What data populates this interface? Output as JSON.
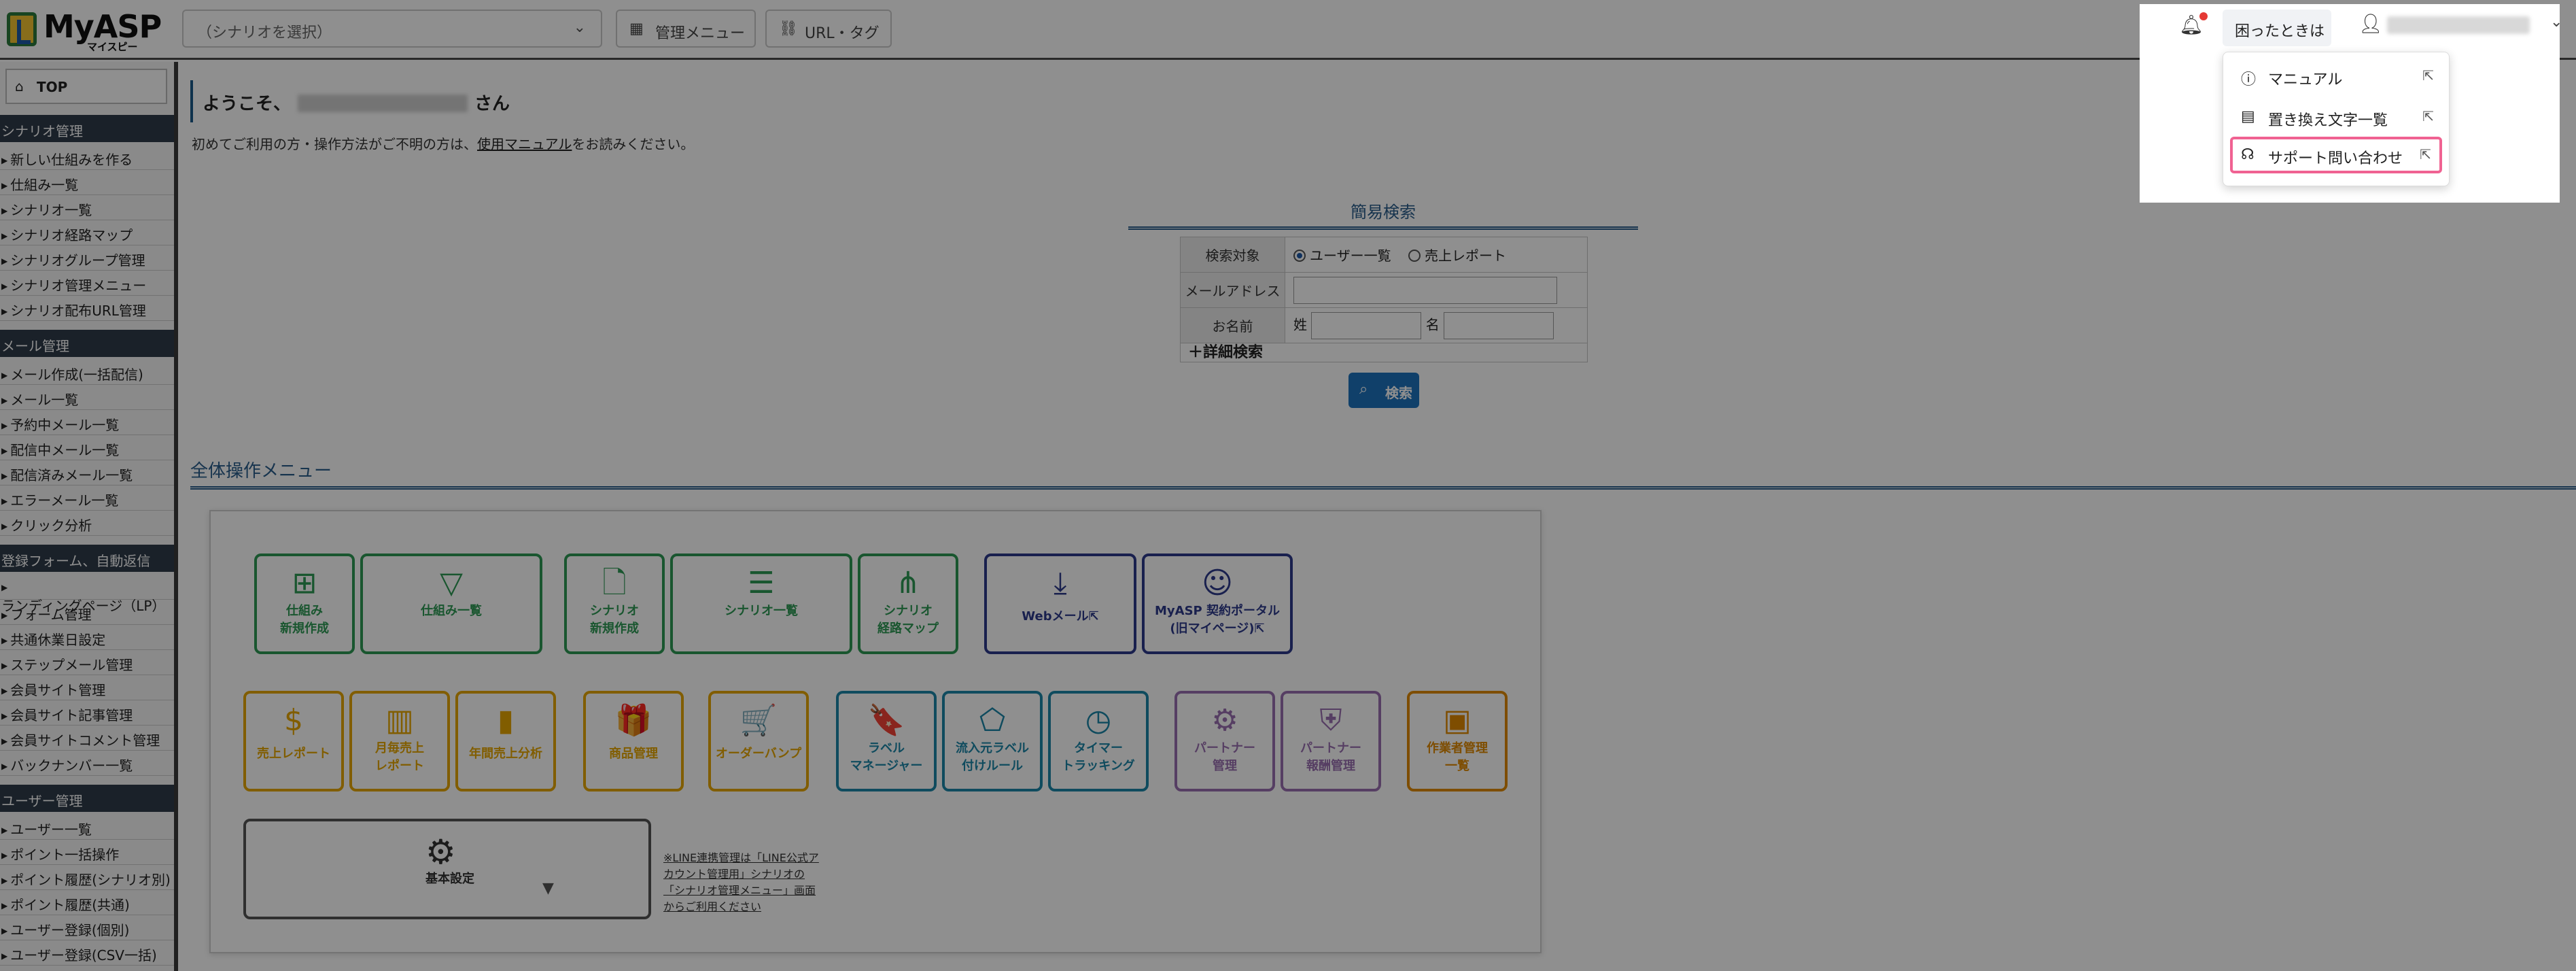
{
  "header": {
    "logo_text": "MyASP",
    "logo_sub": "マイスピー",
    "scenario_select": "（シナリオを選択）",
    "mgmt_menu": "管理メニュー",
    "url_tag": "URL・タグ",
    "help": "困ったときは"
  },
  "help_menu": {
    "items": [
      {
        "label": "マニュアル",
        "icon": "question-circle-icon"
      },
      {
        "label": "置き換え文字一覧",
        "icon": "text-box-icon"
      },
      {
        "label": "サポート問い合わせ",
        "icon": "headset-icon"
      }
    ]
  },
  "sidebar": {
    "top": "TOP",
    "sections": [
      {
        "title": "シナリオ管理",
        "items": [
          "新しい仕組みを作る",
          "仕組み一覧",
          "シナリオ一覧",
          "シナリオ経路マップ",
          "シナリオグループ管理",
          "シナリオ管理メニュー",
          "シナリオ配布URL管理"
        ]
      },
      {
        "title": "メール管理",
        "items": [
          "メール作成(一括配信)",
          "メール一覧",
          "予約中メール一覧",
          "配信中メール一覧",
          "配信済みメール一覧",
          "エラーメール一覧",
          "クリック分析"
        ]
      },
      {
        "title": "登録フォーム、自動返信",
        "items": [
          "ランディングページ（LP）",
          "フォーム管理",
          "共通休業日設定",
          "ステップメール管理",
          "会員サイト管理",
          "会員サイト記事管理",
          "会員サイトコメント管理",
          "バックナンバー一覧"
        ]
      },
      {
        "title": "ユーザー管理",
        "items": [
          "ユーザー一覧",
          "ポイント一括操作",
          "ポイント履歴(シナリオ別)",
          "ポイント履歴(共通)",
          "ユーザー登録(個別)",
          "ユーザー登録(CSV一括)"
        ]
      }
    ]
  },
  "main": {
    "welcome_prefix": "ようこそ、",
    "welcome_suffix": "さん",
    "intro_prefix": "初めてご利用の方・操作方法がご不明の方は、",
    "intro_link": "使用マニュアル",
    "intro_suffix": "をお読みください。",
    "search_title": "簡易検索",
    "search": {
      "target_label": "検索対象",
      "opt_users": "ユーザー一覧",
      "opt_sales": "売上レポート",
      "email_label": "メールアドレス",
      "name_label": "お名前",
      "sei": "姓",
      "mei": "名",
      "advanced": "＋詳細検索",
      "button": "検索"
    },
    "menu_title": "全体操作メニュー",
    "tiles": [
      {
        "label": "仕組み\n新規作成",
        "icon": "⊞"
      },
      {
        "label": "仕組み一覧",
        "icon": "▽"
      },
      {
        "label": "シナリオ\n新規作成",
        "icon": "🗋"
      },
      {
        "label": "シナリオ一覧",
        "icon": "☰"
      },
      {
        "label": "シナリオ\n経路マップ",
        "icon": "⋔"
      },
      {
        "label": "Webメール⇱",
        "icon": "⤓"
      },
      {
        "label": "MyASP 契約ポータル\n(旧マイページ)⇱",
        "icon": "☺"
      },
      {
        "label": "売上レポート",
        "icon": "$"
      },
      {
        "label": "月毎売上\nレポート",
        "icon": "▥"
      },
      {
        "label": "年間売上分析",
        "icon": "▮"
      },
      {
        "label": "商品管理",
        "icon": "🎁"
      },
      {
        "label": "オーダーバンプ",
        "icon": "🛒"
      },
      {
        "label": "ラベル\nマネージャー",
        "icon": "🔖"
      },
      {
        "label": "流入元ラベル\n付けルール",
        "icon": "⬠"
      },
      {
        "label": "タイマー\nトラッキング",
        "icon": "◷"
      },
      {
        "label": "パートナー\n管理",
        "icon": "⚙"
      },
      {
        "label": "パートナー\n報酬管理",
        "icon": "⛨"
      },
      {
        "label": "作業者管理\n一覧",
        "icon": "▣"
      }
    ],
    "basic_settings": "基本設定",
    "line_note": "※LINE連携管理は「LINE公式アカウント管理用」シナリオの「シナリオ管理メニュー」画面からご利用ください"
  },
  "colors": {
    "green": "#2e9a55",
    "navy": "#2d3a8c",
    "yellow": "#e6a700",
    "teal": "#1c86a8",
    "purple": "#9a6fb0",
    "orange": "#e08a00",
    "highlight": "#f06292"
  }
}
